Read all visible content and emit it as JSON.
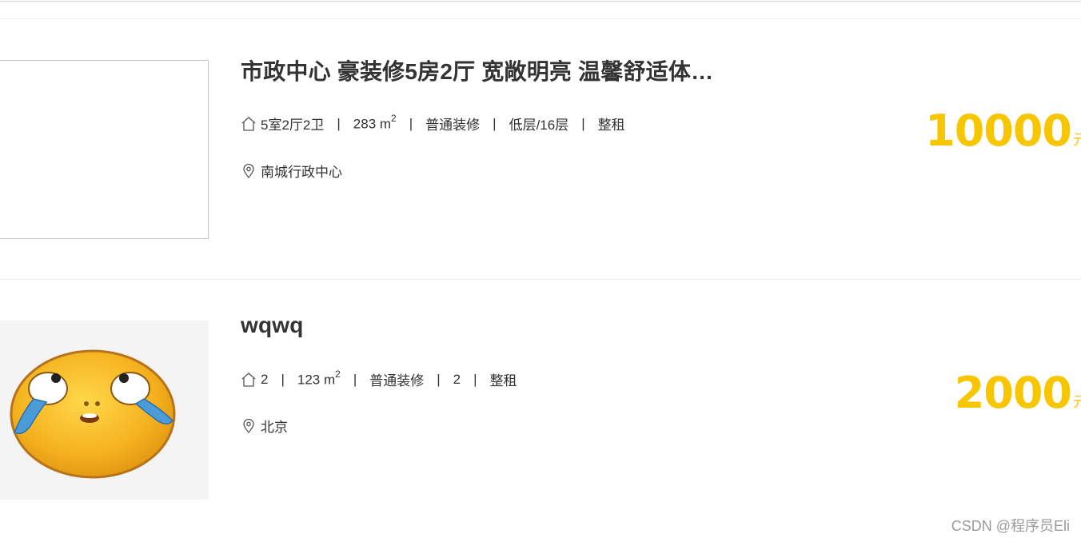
{
  "listings": [
    {
      "title": "市政中心 豪装修5房2厅 宽敞明亮 温馨舒适体…",
      "layout": "5室2厅2卫",
      "area": "283 m",
      "area_sup": "2",
      "decoration": "普通装修",
      "floor": "低层/16层",
      "rent_type": "整租",
      "location": "南城行政中心",
      "price": "10000",
      "price_unit": "元"
    },
    {
      "title": "wqwq",
      "layout": "2",
      "area": "123 m",
      "area_sup": "2",
      "decoration": "普通装修",
      "floor": "2",
      "rent_type": "整租",
      "location": "北京",
      "price": "2000",
      "price_unit": "元"
    }
  ],
  "separator": "|",
  "icons": {
    "house": "house-icon",
    "location": "location-pin-icon"
  },
  "colors": {
    "price": "#f7c600",
    "text": "#333333",
    "watermark": "#9a9a9a"
  },
  "watermark": "CSDN @程序员Eli"
}
